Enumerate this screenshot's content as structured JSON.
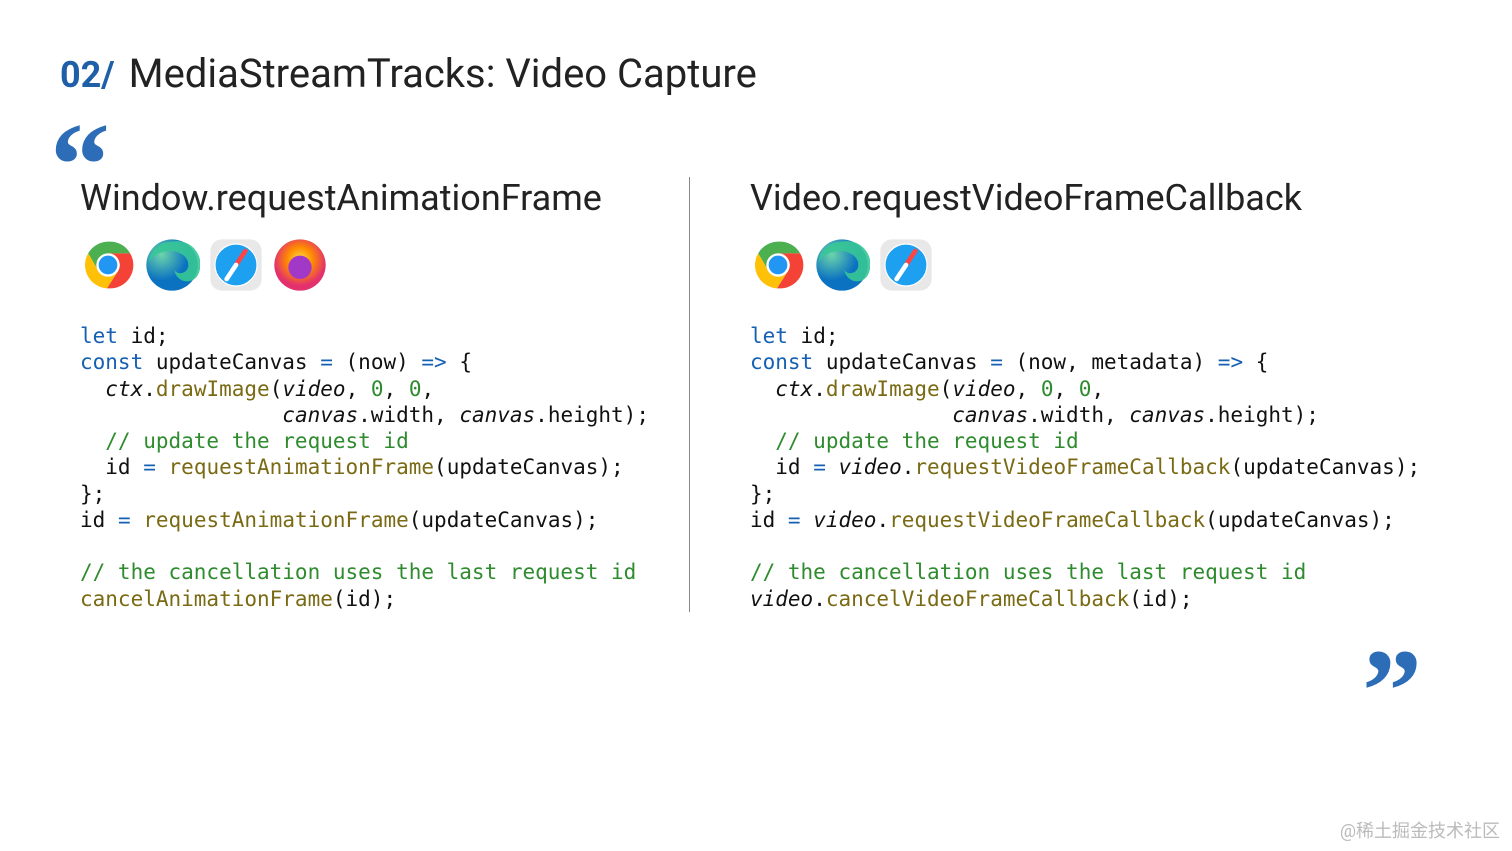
{
  "header": {
    "section_num": "02/",
    "title": "MediaStreamTracks: Video Capture"
  },
  "left": {
    "title": "Window.requestAnimationFrame",
    "browsers": [
      "chrome",
      "edge",
      "safari",
      "firefox"
    ],
    "code": {
      "l1_kw": "let",
      "l1_rest": " id;",
      "l2_kw": "const",
      "l2_name": " updateCanvas ",
      "l2_assign": "=",
      "l2_params": " (now) ",
      "l2_arrow": "=>",
      "l2_brace": " {",
      "l3_indent": "  ",
      "l3_obj": "ctx",
      "l3_dot": ".",
      "l3_fn": "drawImage",
      "l3_open": "(",
      "l3_arg1": "video",
      "l3_comma1": ", ",
      "l3_num1": "0",
      "l3_comma2": ", ",
      "l3_num2": "0",
      "l3_comma3": ",",
      "l4_indent": "                ",
      "l4_arg1": "canvas",
      "l4_dot1": ".width, ",
      "l4_arg2": "canvas",
      "l4_dot2": ".height);",
      "l5": "  // update the request id",
      "l6_a": "  id ",
      "l6_eq": "=",
      "l6_b": " ",
      "l6_fn": "requestAnimationFrame",
      "l6_c": "(updateCanvas);",
      "l7": "};",
      "l8_a": "id ",
      "l8_eq": "=",
      "l8_b": " ",
      "l8_fn": "requestAnimationFrame",
      "l8_c": "(updateCanvas);",
      "l9": "",
      "l10": "// the cancellation uses the last request id",
      "l11_fn": "cancelAnimationFrame",
      "l11_rest": "(id);"
    }
  },
  "right": {
    "title": "Video.requestVideoFrameCallback",
    "browsers": [
      "chrome",
      "edge",
      "safari"
    ],
    "code": {
      "l1_kw": "let",
      "l1_rest": " id;",
      "l2_kw": "const",
      "l2_name": " updateCanvas ",
      "l2_assign": "=",
      "l2_params": " (now, metadata) ",
      "l2_arrow": "=>",
      "l2_brace": " {",
      "l3_indent": "  ",
      "l3_obj": "ctx",
      "l3_dot": ".",
      "l3_fn": "drawImage",
      "l3_open": "(",
      "l3_arg1": "video",
      "l3_comma1": ", ",
      "l3_num1": "0",
      "l3_comma2": ", ",
      "l3_num2": "0",
      "l3_comma3": ",",
      "l4_indent": "                ",
      "l4_arg1": "canvas",
      "l4_dot1": ".width, ",
      "l4_arg2": "canvas",
      "l4_dot2": ".height);",
      "l5": "  // update the request id",
      "l6_a": "  id ",
      "l6_eq": "=",
      "l6_b": " ",
      "l6_obj": "video",
      "l6_dot": ".",
      "l6_fn": "requestVideoFrameCallback",
      "l6_c": "(updateCanvas);",
      "l7": "};",
      "l8_a": "id ",
      "l8_eq": "=",
      "l8_b": " ",
      "l8_obj": "video",
      "l8_dot": ".",
      "l8_fn": "requestVideoFrameCallback",
      "l8_c": "(updateCanvas);",
      "l9": "",
      "l10": "// the cancellation uses the last request id",
      "l11_obj": "video",
      "l11_dot": ".",
      "l11_fn": "cancelVideoFrameCallback",
      "l11_rest": "(id);"
    }
  },
  "watermark": "@稀土掘金技术社区"
}
